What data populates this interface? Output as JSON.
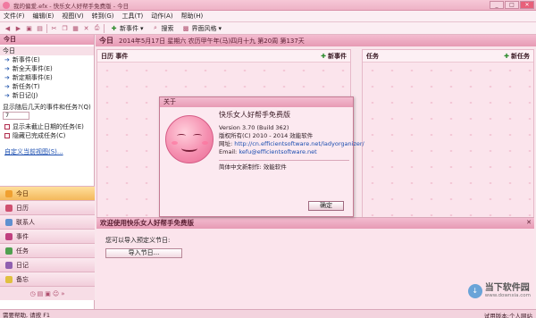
{
  "window": {
    "title": "我的偏爱.efx - 快乐女人好帮手免费版 - 今日",
    "min": "_",
    "max": "□",
    "close": "✕"
  },
  "menu": [
    "文件(F)",
    "编辑(E)",
    "视图(V)",
    "转到(G)",
    "工具(T)",
    "动作(A)",
    "帮助(H)"
  ],
  "toolbar": {
    "new_event": "新事件",
    "search": "搜索",
    "ui_style": "界面风格"
  },
  "left": {
    "header": "今日",
    "section": "今日",
    "items": [
      "新事件(E)",
      "新全天事件(E)",
      "新定期事件(E)",
      "新任务(T)",
      "新日记(J)"
    ],
    "question": "显示随后几天的事件和任务?(Q)",
    "days_value": "7",
    "check1": "显示未截止日期的任务(E)",
    "check2": "隐藏已完成任务(C)",
    "custom_link": "自定义当前视图(S)..."
  },
  "nav": [
    "今日",
    "日历",
    "联系人",
    "事件",
    "任务",
    "日记",
    "备忘"
  ],
  "main": {
    "header_big": "今日",
    "header_date": "2014年5月17日 星期六 农历甲午年(马)四月十九 第20周 第137天",
    "events_col": "日历 事件",
    "new_event": "新事件",
    "tasks_col": "任务",
    "new_task": "新任务"
  },
  "welcome": {
    "title": "欢迎使用快乐女人好帮手免费版",
    "close": "✕",
    "text": "您可以导入预定义节日:",
    "import_btn": "导入节日..."
  },
  "dialog": {
    "title": "关于",
    "name": "快乐女人好帮手免费版",
    "version": "Version 3.70 (Build 362)",
    "copyright": "版权所有(C) 2010 - 2014 效能软件",
    "site_label": "网址:",
    "site": "http://cn.efficientsoftware.net/ladyorganizer/",
    "email_label": "Email:",
    "email": "kefu@efficientsoftware.net",
    "localized": "简体中文新制作: 效能软件",
    "ok": "确定"
  },
  "status": {
    "left": "需要帮助, 请按 F1",
    "right": "试用版本:个人网站"
  },
  "watermark": {
    "name": "当下软件园",
    "url": "www.downxia.com"
  },
  "colors": {
    "accent": "#e79ab4",
    "active_nav": "#f4b85b",
    "link": "#1a4db0"
  }
}
